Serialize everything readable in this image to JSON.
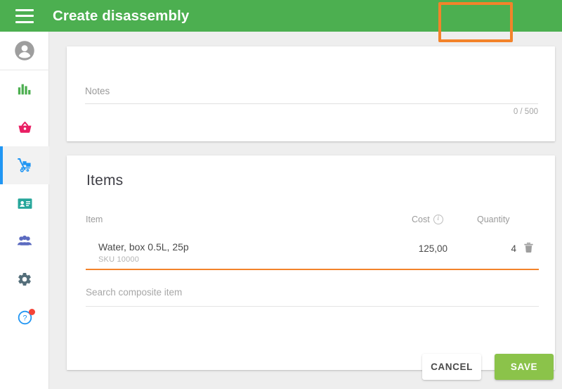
{
  "appbar": {
    "menu_icon": "hamburger-menu-icon",
    "title": "Create disassembly",
    "bg_color": "#4caf50"
  },
  "sidebar": {
    "items": [
      {
        "name": "avatar",
        "icon": "user-avatar-icon",
        "color": "#9e9e9e",
        "active": false
      },
      {
        "name": "reports",
        "icon": "bar-chart-icon",
        "color": "#4caf50",
        "active": false
      },
      {
        "name": "sales",
        "icon": "shopping-basket-icon",
        "color": "#e91e63",
        "active": false
      },
      {
        "name": "inventory",
        "icon": "hand-truck-icon",
        "color": "#2196f3",
        "active": true
      },
      {
        "name": "employees",
        "icon": "id-card-icon",
        "color": "#26a69a",
        "active": false
      },
      {
        "name": "customers",
        "icon": "people-group-icon",
        "color": "#5c6bc0",
        "active": false
      },
      {
        "name": "settings",
        "icon": "gear-icon",
        "color": "#546e7a",
        "active": false
      },
      {
        "name": "help",
        "icon": "help-question-icon",
        "color": "#2196f3",
        "active": false,
        "badge": true
      }
    ],
    "active_indicator_color": "#2196f3"
  },
  "notes_card": {
    "label": "Notes",
    "value": "",
    "counter": "0 / 500"
  },
  "items_card": {
    "title": "Items",
    "columns": {
      "item": "Item",
      "cost": "Cost",
      "cost_info_icon": "info-circle-icon",
      "quantity": "Quantity"
    },
    "rows": [
      {
        "name": "Water, box 0.5L, 25p",
        "sku": "SKU 10000",
        "cost": "125,00",
        "quantity": "4",
        "delete_icon": "trash-can-icon",
        "highlighted": true
      }
    ],
    "search": {
      "placeholder": "Search composite item",
      "value": ""
    }
  },
  "footer": {
    "cancel_label": "CANCEL",
    "save_label": "SAVE",
    "save_color": "#8bc34a"
  },
  "annotation": {
    "highlight_color": "#f3832a",
    "targets": [
      "save-button",
      "item-row"
    ]
  }
}
